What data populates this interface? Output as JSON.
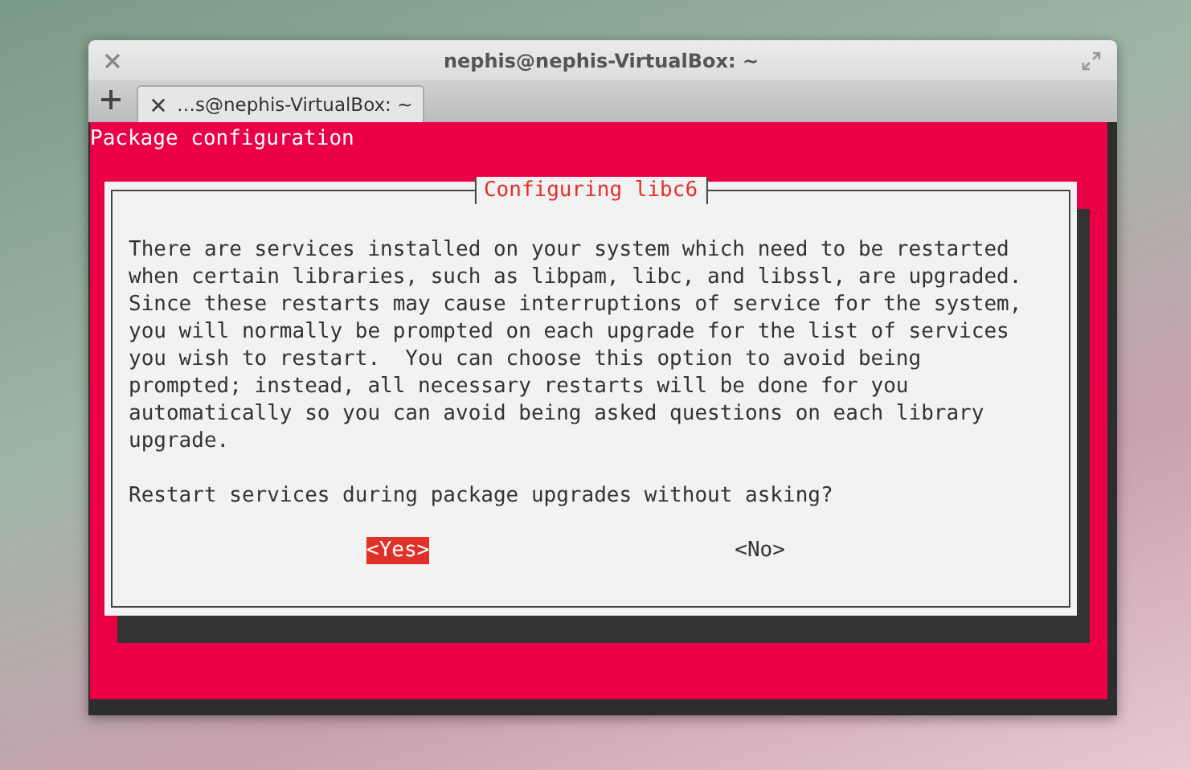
{
  "window": {
    "title": "nephis@nephis-VirtualBox: ~"
  },
  "tabs": [
    {
      "label": "…s@nephis-VirtualBox: ~",
      "selected": true
    }
  ],
  "terminal": {
    "header": "Package configuration",
    "dialog": {
      "title": "Configuring libc6",
      "message": "There are services installed on your system which need to be restarted\nwhen certain libraries, such as libpam, libc, and libssl, are upgraded.\nSince these restarts may cause interruptions of service for the system,\nyou will normally be prompted on each upgrade for the list of services\nyou wish to restart.  You can choose this option to avoid being\nprompted; instead, all necessary restarts will be done for you\nautomatically so you can avoid being asked questions on each library\nupgrade.",
      "question": "Restart services during package upgrades without asking?",
      "buttons": [
        {
          "label": "<Yes>",
          "selected": true
        },
        {
          "label": "<No>",
          "selected": false
        }
      ]
    }
  }
}
